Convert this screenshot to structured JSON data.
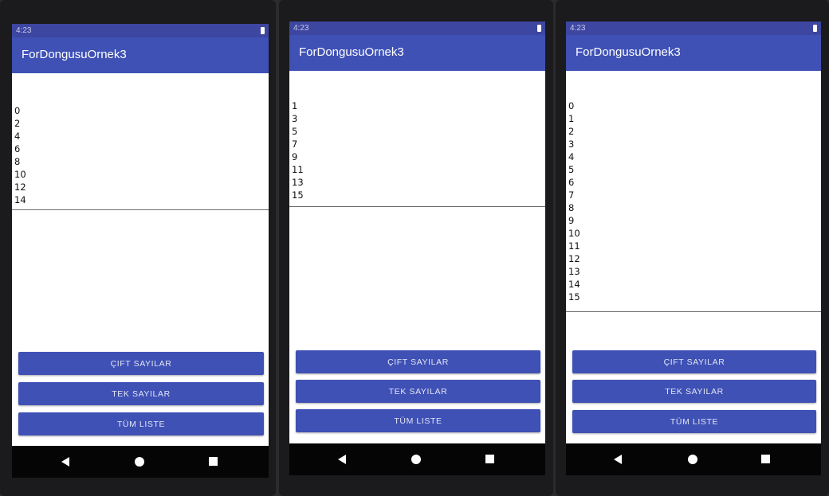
{
  "phones": [
    {
      "status_time": "4:23",
      "app_title": "ForDongusuOrnek3",
      "items": [
        "0",
        "2",
        "4",
        "6",
        "8",
        "10",
        "12",
        "14"
      ],
      "buttons": {
        "even": "ÇIFT SAYILAR",
        "odd": "TEK SAYILAR",
        "all": "TÜM LISTE"
      }
    },
    {
      "status_time": "4:23",
      "app_title": "ForDongusuOrnek3",
      "items": [
        "1",
        "3",
        "5",
        "7",
        "9",
        "11",
        "13",
        "15"
      ],
      "buttons": {
        "even": "ÇIFT SAYILAR",
        "odd": "TEK SAYILAR",
        "all": "TÜM LISTE"
      }
    },
    {
      "status_time": "4:23",
      "app_title": "ForDongusuOrnek3",
      "items": [
        "0",
        "1",
        "2",
        "3",
        "4",
        "5",
        "6",
        "7",
        "8",
        "9",
        "10",
        "11",
        "12",
        "13",
        "14",
        "15"
      ],
      "buttons": {
        "even": "ÇIFT SAYILAR",
        "odd": "TEK SAYILAR",
        "all": "TÜM LISTE"
      }
    }
  ],
  "navbar_icons": [
    "back-icon",
    "home-icon",
    "recent-apps-icon"
  ],
  "colors": {
    "primary": "#3f51b5",
    "status_bar": "#3d46a0",
    "nav_bar": "#050505"
  }
}
